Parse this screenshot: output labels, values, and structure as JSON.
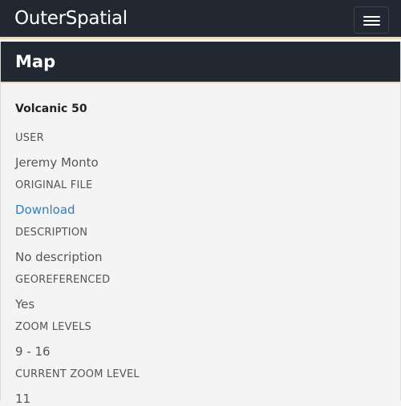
{
  "navbar": {
    "brand": "OuterSpatial",
    "menu_icon": "hamburger-menu-icon"
  },
  "panel": {
    "title": "Map"
  },
  "map": {
    "name": "Volcanic 50",
    "fields": {
      "user_label": "USER",
      "user_value": "Jeremy Monto",
      "original_file_label": "ORIGINAL FILE",
      "original_file_link": "Download",
      "description_label": "DESCRIPTION",
      "description_value": "No description",
      "georeferenced_label": "GEOREFERENCED",
      "georeferenced_value": "Yes",
      "zoom_levels_label": "ZOOM LEVELS",
      "zoom_levels_value": "9 - 16",
      "current_zoom_label": "CURRENT ZOOM LEVEL",
      "current_zoom_value": "11"
    }
  },
  "colors": {
    "navbar_bg": "#222831",
    "accent_border": "#e8d9bf",
    "link": "#2f7fc0",
    "body_bg": "#f4f4f4"
  }
}
